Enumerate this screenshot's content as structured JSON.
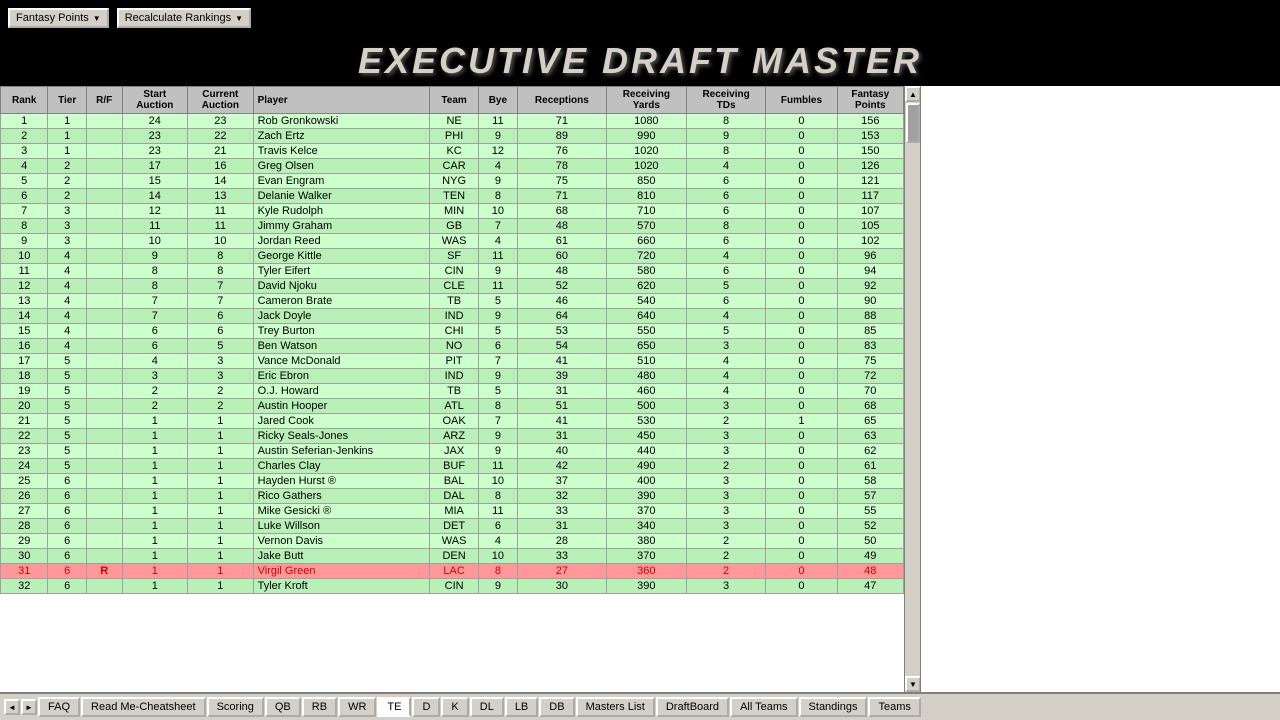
{
  "header": {
    "title": "EXECUTIVE DRAFT MASTER",
    "dropdown1": "Fantasy Points",
    "dropdown2": "Recalculate Rankings"
  },
  "table": {
    "columns": [
      "Rank",
      "Tier",
      "R/F",
      "Start Auction",
      "Current Auction",
      "Player",
      "Team",
      "Bye",
      "Receptions",
      "Receiving Yards",
      "Receiving TDs",
      "Fumbles",
      "Fantasy Points"
    ],
    "rows": [
      [
        1,
        1,
        "",
        24,
        23,
        "Rob Gronkowski",
        "NE",
        11,
        71,
        1080,
        8,
        0,
        156.0,
        false
      ],
      [
        2,
        1,
        "",
        23,
        22,
        "Zach Ertz",
        "PHI",
        9,
        89,
        990,
        9,
        0,
        153.0,
        false
      ],
      [
        3,
        1,
        "",
        23,
        21,
        "Travis Kelce",
        "KC",
        12,
        76,
        1020,
        8,
        0,
        150.0,
        false
      ],
      [
        4,
        2,
        "",
        17,
        16,
        "Greg Olsen",
        "CAR",
        4,
        78,
        1020,
        4,
        0,
        126.0,
        false
      ],
      [
        5,
        2,
        "",
        15,
        14,
        "Evan Engram",
        "NYG",
        9,
        75,
        850,
        6,
        0,
        121.0,
        false
      ],
      [
        6,
        2,
        "",
        14,
        13,
        "Delanie Walker",
        "TEN",
        8,
        71,
        810,
        6,
        0,
        117.0,
        false
      ],
      [
        7,
        3,
        "",
        12,
        11,
        "Kyle Rudolph",
        "MIN",
        10,
        68,
        710,
        6,
        0,
        107.0,
        false
      ],
      [
        8,
        3,
        "",
        11,
        11,
        "Jimmy Graham",
        "GB",
        7,
        48,
        570,
        8,
        0,
        105.0,
        false
      ],
      [
        9,
        3,
        "",
        10,
        10,
        "Jordan Reed",
        "WAS",
        4,
        61,
        660,
        6,
        0,
        102.0,
        false
      ],
      [
        10,
        4,
        "",
        9,
        8,
        "George Kittle",
        "SF",
        11,
        60,
        720,
        4,
        0,
        96.0,
        false
      ],
      [
        11,
        4,
        "",
        8,
        8,
        "Tyler Eifert",
        "CIN",
        9,
        48,
        580,
        6,
        0,
        94.0,
        false
      ],
      [
        12,
        4,
        "",
        8,
        7,
        "David Njoku",
        "CLE",
        11,
        52,
        620,
        5,
        0,
        92.0,
        false
      ],
      [
        13,
        4,
        "",
        7,
        7,
        "Cameron Brate",
        "TB",
        5,
        46,
        540,
        6,
        0,
        90.0,
        false
      ],
      [
        14,
        4,
        "",
        7,
        6,
        "Jack Doyle",
        "IND",
        9,
        64,
        640,
        4,
        0,
        88.0,
        false
      ],
      [
        15,
        4,
        "",
        6,
        6,
        "Trey Burton",
        "CHI",
        5,
        53,
        550,
        5,
        0,
        85.0,
        false
      ],
      [
        16,
        4,
        "",
        6,
        5,
        "Ben Watson",
        "NO",
        6,
        54,
        650,
        3,
        0,
        83.0,
        false
      ],
      [
        17,
        5,
        "",
        4,
        3,
        "Vance McDonald",
        "PIT",
        7,
        41,
        510,
        4,
        0,
        75.0,
        false
      ],
      [
        18,
        5,
        "",
        3,
        3,
        "Eric Ebron",
        "IND",
        9,
        39,
        480,
        4,
        0,
        72.0,
        false
      ],
      [
        19,
        5,
        "",
        2,
        2,
        "O.J. Howard",
        "TB",
        5,
        31,
        460,
        4,
        0,
        70.0,
        false
      ],
      [
        20,
        5,
        "",
        2,
        2,
        "Austin Hooper",
        "ATL",
        8,
        51,
        500,
        3,
        0,
        68.0,
        false
      ],
      [
        21,
        5,
        "",
        1,
        1,
        "Jared Cook",
        "OAK",
        7,
        41,
        530,
        2,
        1,
        65.0,
        false
      ],
      [
        22,
        5,
        "",
        1,
        1,
        "Ricky Seals-Jones",
        "ARZ",
        9,
        31,
        450,
        3,
        0,
        63.0,
        false
      ],
      [
        23,
        5,
        "",
        1,
        1,
        "Austin Seferian-Jenkins",
        "JAX",
        9,
        40,
        440,
        3,
        0,
        62.0,
        false
      ],
      [
        24,
        5,
        "",
        1,
        1,
        "Charles Clay",
        "BUF",
        11,
        42,
        490,
        2,
        0,
        61.0,
        false
      ],
      [
        25,
        6,
        "",
        1,
        1,
        "Hayden Hurst ®",
        "BAL",
        10,
        37,
        400,
        3,
        0,
        58.0,
        false
      ],
      [
        26,
        6,
        "",
        1,
        1,
        "Rico Gathers",
        "DAL",
        8,
        32,
        390,
        3,
        0,
        57.0,
        false
      ],
      [
        27,
        6,
        "",
        1,
        1,
        "Mike Gesicki ®",
        "MIA",
        11,
        33,
        370,
        3,
        0,
        55.0,
        false
      ],
      [
        28,
        6,
        "",
        1,
        1,
        "Luke Willson",
        "DET",
        6,
        31,
        340,
        3,
        0,
        52.0,
        false
      ],
      [
        29,
        6,
        "",
        1,
        1,
        "Vernon Davis",
        "WAS",
        4,
        28,
        380,
        2,
        0,
        50.0,
        false
      ],
      [
        30,
        6,
        "",
        1,
        1,
        "Jake Butt",
        "DEN",
        10,
        33,
        370,
        2,
        0,
        49.0,
        false
      ],
      [
        31,
        6,
        "R",
        1,
        1,
        "Virgil Green",
        "LAC",
        8,
        27,
        360,
        2,
        0,
        48.0,
        true
      ],
      [
        32,
        6,
        "",
        1,
        1,
        "Tyler Kroft",
        "CIN",
        9,
        30,
        390,
        3,
        0,
        47.0,
        false
      ]
    ]
  },
  "tabs": {
    "items": [
      "FAQ",
      "Read Me-Cheatsheet",
      "Scoring",
      "QB",
      "RB",
      "WR",
      "TE",
      "D",
      "K",
      "DL",
      "LB",
      "DB",
      "Masters List",
      "DraftBoard",
      "All Teams",
      "Standings",
      "Teams"
    ]
  }
}
